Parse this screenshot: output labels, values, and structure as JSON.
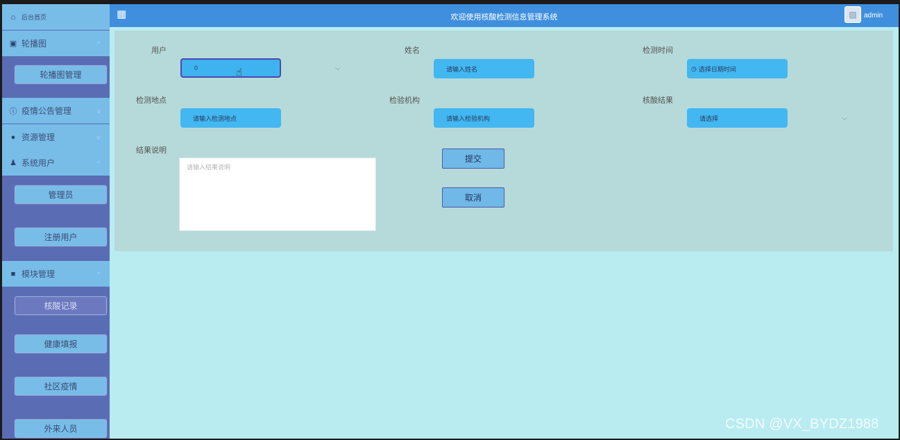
{
  "sidebar": {
    "home": {
      "icon": "home-icon",
      "label": "后台首页"
    },
    "groups": [
      {
        "icon": "image-icon",
        "label": "轮播图",
        "chevron": "chevron-up-icon",
        "items": [
          "轮播图管理"
        ]
      },
      {
        "icon": "info-circle-icon",
        "label": "疫情公告管理",
        "chevron": "chevron-down-icon",
        "items": []
      },
      {
        "icon": "location-pin-icon",
        "label": "资源管理",
        "chevron": "chevron-down-icon",
        "items": []
      },
      {
        "icon": "user-icon",
        "label": "系统用户",
        "chevron": "chevron-up-icon",
        "items": [
          "管理员",
          "注册用户"
        ]
      },
      {
        "icon": "grid-icon",
        "label": "模块管理",
        "chevron": "chevron-up-icon",
        "items": [
          "核酸记录",
          "健康填报",
          "社区疫情",
          "外来人员"
        ]
      }
    ]
  },
  "header": {
    "title": "欢迎使用核酸检测信息管理系统",
    "user": "admin",
    "menu_icon": "grid-menu-icon",
    "avatar_icon": "avatar-image-icon"
  },
  "form": {
    "user_label": "用户",
    "user_value": "0",
    "name_label": "姓名",
    "name_placeholder": "请输入姓名",
    "time_label": "检测时间",
    "time_placeholder": "选择日期时间",
    "location_label": "检测地点",
    "location_placeholder": "请输入检测地点",
    "org_label": "检验机构",
    "org_placeholder": "请输入检验机构",
    "result_label": "核酸结果",
    "result_placeholder": "请选择",
    "desc_label": "结果说明",
    "desc_placeholder": "请输入结果说明",
    "submit": "提交",
    "cancel": "取消"
  },
  "watermark": "CSDN @VX_BYDZ1988",
  "colors": {
    "sidebar": "#5a6cb3",
    "sidebar_item": "#77bde8",
    "header": "#3f8fde",
    "content": "#b9ecf1",
    "panel": "#b6dad9",
    "field": "#42b7f2"
  }
}
